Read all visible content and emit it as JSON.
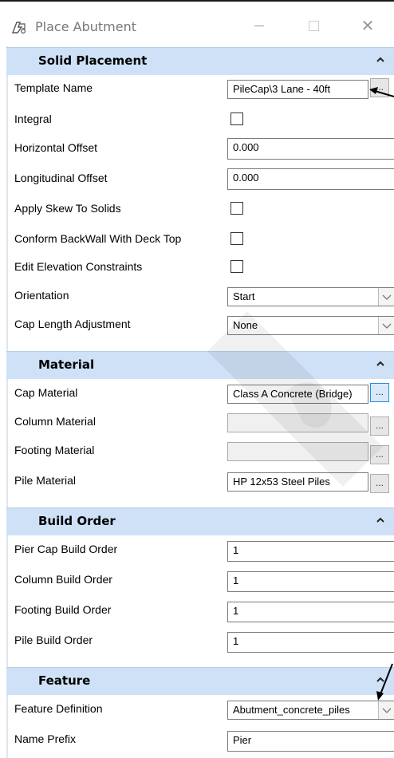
{
  "window": {
    "title": "Place Abutment"
  },
  "sections": {
    "solid": {
      "title": "Solid Placement",
      "template_name": {
        "label": "Template Name",
        "value": "PileCap\\3 Lane - 40ft"
      },
      "integral": {
        "label": "Integral"
      },
      "horizontal_offset": {
        "label": "Horizontal Offset",
        "value": "0.000"
      },
      "longitudinal_offset": {
        "label": "Longitudinal Offset",
        "value": "0.000"
      },
      "apply_skew": {
        "label": "Apply Skew To Solids"
      },
      "conform_backwall": {
        "label": "Conform BackWall With Deck Top"
      },
      "edit_elevation": {
        "label": "Edit Elevation Constraints"
      },
      "orientation": {
        "label": "Orientation",
        "value": "Start"
      },
      "cap_length": {
        "label": "Cap Length Adjustment",
        "value": "None"
      }
    },
    "material": {
      "title": "Material",
      "cap": {
        "label": "Cap Material",
        "value": "Class A Concrete (Bridge)"
      },
      "column": {
        "label": "Column Material",
        "value": ""
      },
      "footing": {
        "label": "Footing Material",
        "value": ""
      },
      "pile": {
        "label": "Pile Material",
        "value": "HP 12x53 Steel Piles"
      }
    },
    "build": {
      "title": "Build Order",
      "pier_cap": {
        "label": "Pier Cap Build Order",
        "value": "1"
      },
      "column": {
        "label": "Column Build Order",
        "value": "1"
      },
      "footing": {
        "label": "Footing Build Order",
        "value": "1"
      },
      "pile": {
        "label": "Pile Build Order",
        "value": "1"
      }
    },
    "feature": {
      "title": "Feature",
      "definition": {
        "label": "Feature Definition",
        "value": "Abutment_concrete_piles"
      },
      "prefix": {
        "label": "Name Prefix",
        "value": "Pier"
      }
    }
  },
  "button_text": "...",
  "colors": {
    "section_header": "#cfe1f7",
    "accent": "#2b8ce0"
  }
}
